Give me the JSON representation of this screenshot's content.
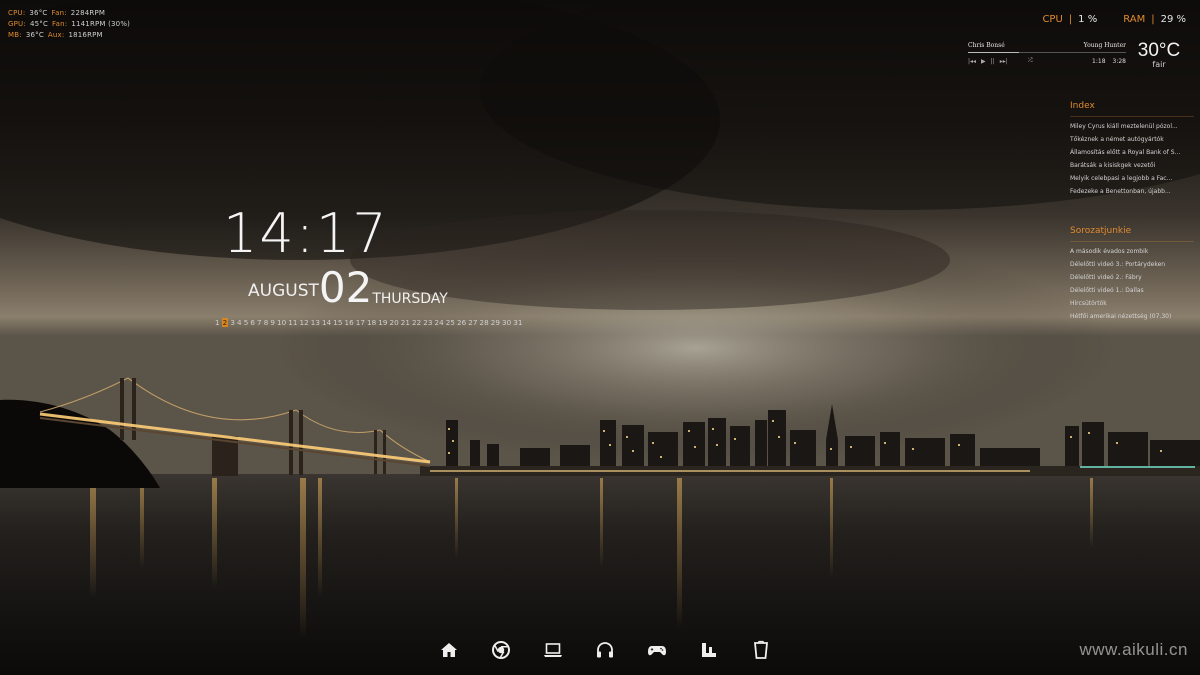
{
  "colors": {
    "accent": "#e08a2e",
    "text": "#e6e6e6",
    "today_bg": "#d8861f"
  },
  "hardware_monitor": [
    {
      "label1": "CPU:",
      "value1": "36°C",
      "label2": "Fan:",
      "value2": "2284RPM"
    },
    {
      "label1": "GPU:",
      "value1": "45°C",
      "label2": "Fan:",
      "value2": "1141RPM (30%)"
    },
    {
      "label1": "MB:",
      "value1": "36°C",
      "label2": "Aux:",
      "value2": "1816RPM"
    }
  ],
  "system_load": {
    "cpu_label": "CPU",
    "cpu_value": "1 %",
    "ram_label": "RAM",
    "ram_value": "29 %",
    "separator": "|"
  },
  "music_player": {
    "artist": "Chris Bonsé",
    "track": "Young Hunter",
    "progress": 0.32,
    "controls": [
      "|◂◂",
      "▶",
      "||",
      "▸▸|",
      "⤮"
    ],
    "elapsed": "1:18",
    "duration": "3:28",
    "control_icons": [
      "prev-icon",
      "play-icon",
      "pause-icon",
      "next-icon",
      "shuffle-icon"
    ]
  },
  "weather": {
    "temperature": "30°C",
    "condition": "fair"
  },
  "feeds": {
    "index": {
      "title": "Index",
      "items": [
        "Miley Cyrus kiáll meztelenül pózol...",
        "Tőkéznek a német autógyártók",
        "Államosítás előtt a Royal Bank of S...",
        "Barátsák a kisiskgek vezetői",
        "Melyik celebpasi a legjobb a Fac...",
        "Fedezeke a Benettonban, újabb..."
      ]
    },
    "sorozatjunkie": {
      "title": "Sorozatjunkie",
      "items": [
        "A második évados zombik",
        "Délelőtti videó 3.: Portárydeken",
        "Délelőtti videó 2.: Fábry",
        "Délelőtti videó 1.: Dallas",
        "Hírcsütörtök",
        "Hétfői amerikai nézettség (07.30)"
      ]
    }
  },
  "clock": {
    "time": "14:17",
    "month": "AUGUST",
    "day": "02",
    "weekday": "THURSDAY"
  },
  "calendar": {
    "days": [
      "1",
      "2",
      "3",
      "4",
      "5",
      "6",
      "7",
      "8",
      "9",
      "10",
      "11",
      "12",
      "13",
      "14",
      "15",
      "16",
      "17",
      "18",
      "19",
      "20",
      "21",
      "22",
      "23",
      "24",
      "25",
      "26",
      "27",
      "28",
      "29",
      "30",
      "31"
    ],
    "today_index": 1
  },
  "dock": [
    {
      "name": "home-icon"
    },
    {
      "name": "chrome-icon"
    },
    {
      "name": "laptop-icon"
    },
    {
      "name": "headphones-icon"
    },
    {
      "name": "gamepad-icon"
    },
    {
      "name": "steam-icon"
    },
    {
      "name": "trash-icon"
    }
  ],
  "watermark": "www.aikuli.cn"
}
